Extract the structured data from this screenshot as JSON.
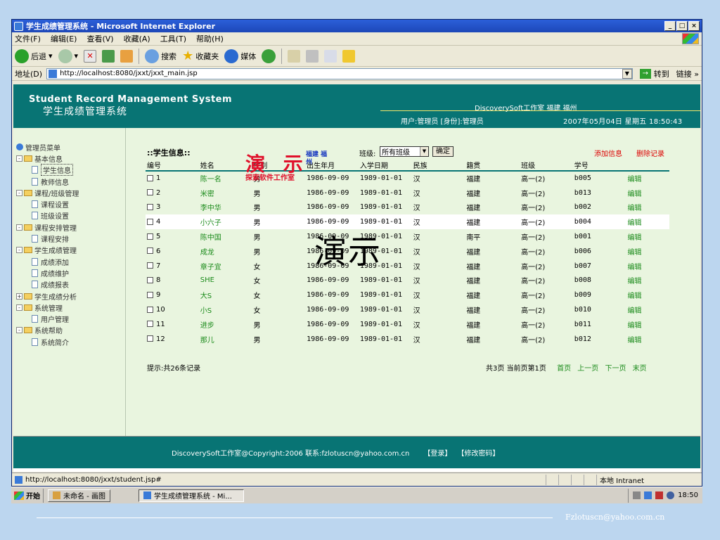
{
  "window": {
    "title": "学生成绩管理系统 - Microsoft Internet Explorer",
    "controls": [
      "_",
      "□",
      "×"
    ]
  },
  "menu": [
    "文件(F)",
    "编辑(E)",
    "查看(V)",
    "收藏(A)",
    "工具(T)",
    "帮助(H)"
  ],
  "toolbar": {
    "back": "后退",
    "search": "搜索",
    "favorites": "收藏夹",
    "media": "媒体"
  },
  "address": {
    "label": "地址(D)",
    "url": "http://localhost:8080/jxxt/jxxt_main.jsp",
    "go": "转到",
    "links": "链接 »"
  },
  "header": {
    "title_en": "Student Record Management System",
    "title_cn": "学生成绩管理系统",
    "studio": "DiscoverySoft工作室 福建 福州",
    "user": "用户:管理员 [身份]:管理员",
    "datetime": "2007年05月04日 星期五 18:50:43"
  },
  "sidebar": [
    {
      "label": "管理员菜单",
      "level": 0,
      "type": "root"
    },
    {
      "label": "基本信息",
      "level": 1,
      "type": "folder",
      "sign": "-"
    },
    {
      "label": "学生信息",
      "level": 2,
      "type": "doc",
      "selected": true
    },
    {
      "label": "教师信息",
      "level": 2,
      "type": "doc"
    },
    {
      "label": "课程/班级管理",
      "level": 1,
      "type": "folder",
      "sign": "-"
    },
    {
      "label": "课程设置",
      "level": 2,
      "type": "doc"
    },
    {
      "label": "班级设置",
      "level": 2,
      "type": "doc"
    },
    {
      "label": "课程安排管理",
      "level": 1,
      "type": "folder",
      "sign": "-"
    },
    {
      "label": "课程安排",
      "level": 2,
      "type": "doc"
    },
    {
      "label": "学生成绩管理",
      "level": 1,
      "type": "folder",
      "sign": "-"
    },
    {
      "label": "成绩添加",
      "level": 2,
      "type": "doc"
    },
    {
      "label": "成绩维护",
      "level": 2,
      "type": "doc"
    },
    {
      "label": "成绩报表",
      "level": 2,
      "type": "doc"
    },
    {
      "label": "学生成绩分析",
      "level": 1,
      "type": "folder",
      "sign": "+"
    },
    {
      "label": "系统管理",
      "level": 1,
      "type": "folder",
      "sign": "-"
    },
    {
      "label": "用户管理",
      "level": 2,
      "type": "doc"
    },
    {
      "label": "系统帮助",
      "level": 1,
      "type": "folder",
      "sign": "-"
    },
    {
      "label": "系统简介",
      "level": 2,
      "type": "doc"
    }
  ],
  "panel": {
    "title": "::学生信息::",
    "class_label": "班级:",
    "class_value": "所有班级",
    "ok": "确定",
    "add": "添加信息",
    "delete": "删除记录",
    "stamp_big": "演 示",
    "stamp_small": "福建 福州",
    "stamp_red": "探索软件工作室",
    "watermark": "演示",
    "columns": [
      "编号",
      "姓名",
      "性别",
      "出生年月",
      "入学日期",
      "民族",
      "籍贯",
      "班级",
      "学号",
      ""
    ],
    "rows": [
      [
        "1",
        "陈一名",
        "男",
        "1986-09-09",
        "1989-01-01",
        "汉",
        "福建",
        "高一(2)",
        "b005",
        "编辑"
      ],
      [
        "2",
        "米密",
        "男",
        "1986-09-09",
        "1989-01-01",
        "汉",
        "福建",
        "高一(2)",
        "b013",
        "编辑"
      ],
      [
        "3",
        "李中华",
        "男",
        "1986-09-09",
        "1989-01-01",
        "汉",
        "福建",
        "高一(2)",
        "b002",
        "编辑"
      ],
      [
        "4",
        "小六子",
        "男",
        "1986-09-09",
        "1989-01-01",
        "汉",
        "福建",
        "高一(2)",
        "b004",
        "编辑"
      ],
      [
        "5",
        "陈中国",
        "男",
        "1986-09-09",
        "1989-01-01",
        "汉",
        "南平",
        "高一(2)",
        "b001",
        "编辑"
      ],
      [
        "6",
        "成龙",
        "男",
        "1986-09-09",
        "1989-01-01",
        "汉",
        "福建",
        "高一(2)",
        "b006",
        "编辑"
      ],
      [
        "7",
        "章子宜",
        "女",
        "1986-09-09",
        "1989-01-01",
        "汉",
        "福建",
        "高一(2)",
        "b007",
        "编辑"
      ],
      [
        "8",
        "SHE",
        "女",
        "1986-09-09",
        "1989-01-01",
        "汉",
        "福建",
        "高一(2)",
        "b008",
        "编辑"
      ],
      [
        "9",
        "大S",
        "女",
        "1986-09-09",
        "1989-01-01",
        "汉",
        "福建",
        "高一(2)",
        "b009",
        "编辑"
      ],
      [
        "10",
        "小S",
        "女",
        "1986-09-09",
        "1989-01-01",
        "汉",
        "福建",
        "高一(2)",
        "b010",
        "编辑"
      ],
      [
        "11",
        "进步",
        "男",
        "1986-09-09",
        "1989-01-01",
        "汉",
        "福建",
        "高一(2)",
        "b011",
        "编辑"
      ],
      [
        "12",
        "那儿",
        "男",
        "1986-09-09",
        "1989-01-01",
        "汉",
        "福建",
        "高一(2)",
        "b012",
        "编辑"
      ]
    ],
    "hint": "提示:共26条记录",
    "pager": {
      "info": "共3页 当前页第1页",
      "first": "首页",
      "prev": "上一页",
      "next": "下一页",
      "last": "末页"
    }
  },
  "footer": {
    "copyright": "DiscoverySoft工作室@Copyright:2006 联系:fzlotuscn@yahoo.com.cn",
    "login": "【登录】",
    "changepw": "【修改密码】"
  },
  "statusbar": {
    "url": "http://localhost:8080/jxxt/student.jsp#",
    "zone": "本地 Intranet"
  },
  "taskbar": {
    "start": "开始",
    "tasks": [
      "未命名 - 画图",
      "学生成绩管理系统 - Mi..."
    ],
    "time": "18:50"
  },
  "slide": {
    "email": "Fzlotuscn@yahoo.com.cn"
  }
}
